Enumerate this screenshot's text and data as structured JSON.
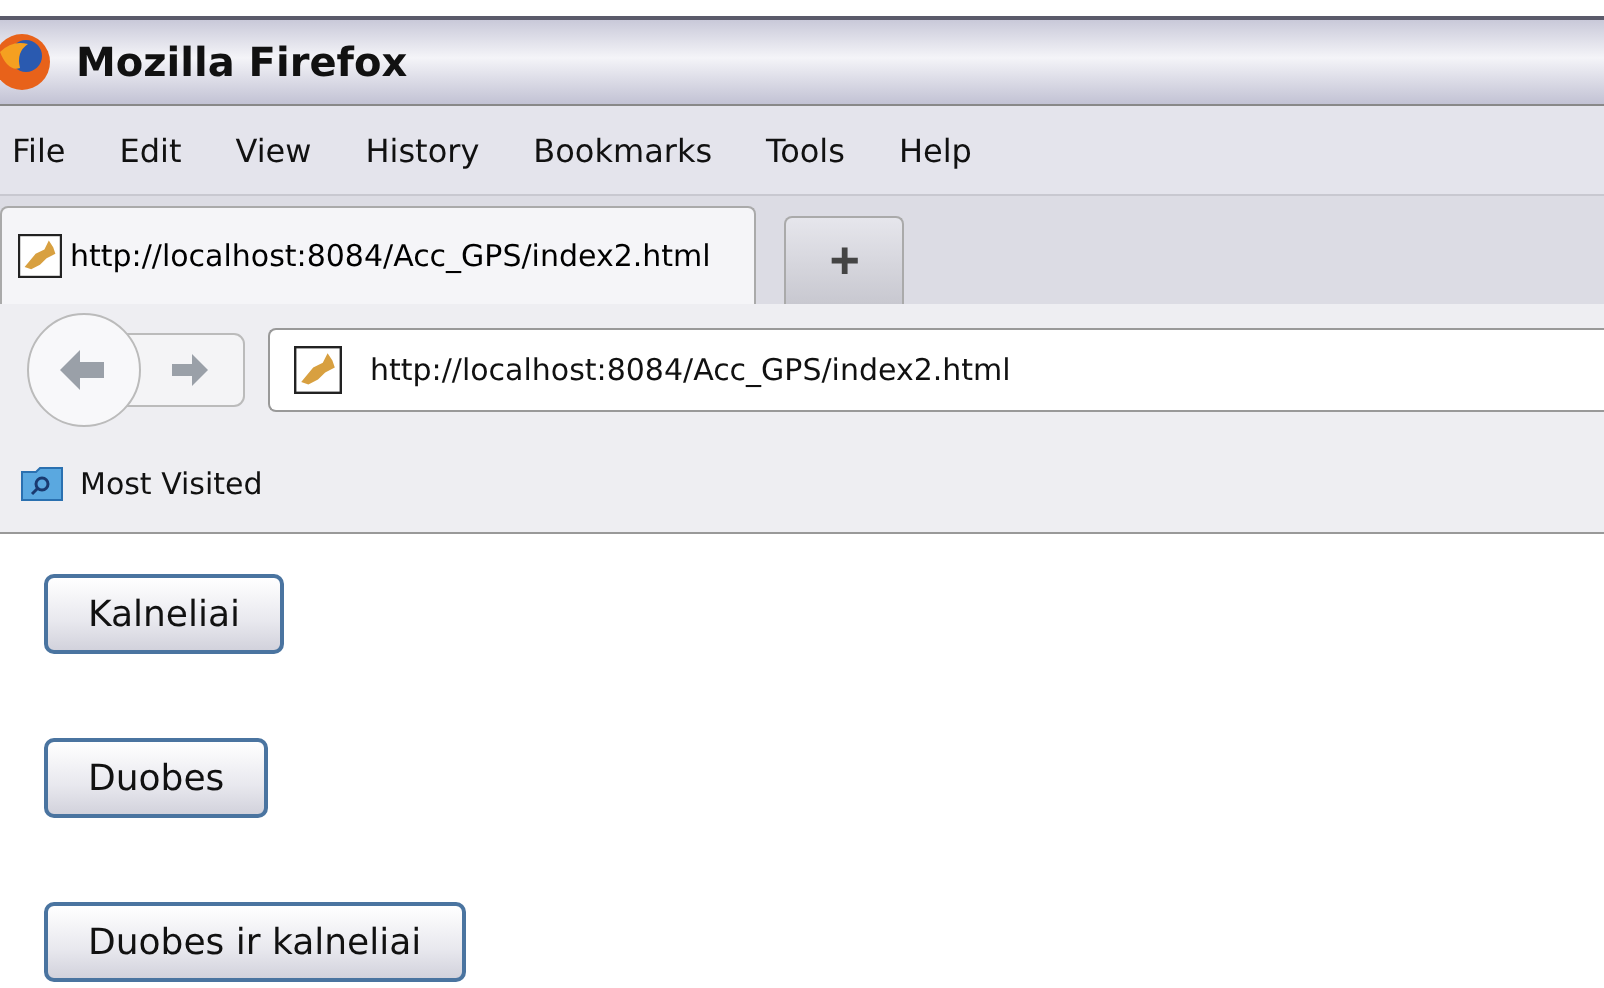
{
  "window": {
    "title": "Mozilla Firefox"
  },
  "menu": [
    "File",
    "Edit",
    "View",
    "History",
    "Bookmarks",
    "Tools",
    "Help"
  ],
  "tabs": [
    {
      "label": "http://localhost:8084/Acc_GPS/index2.html",
      "selected": true
    }
  ],
  "new_tab": "+",
  "address": {
    "value": "http://localhost:8084/Acc_GPS/index2.html"
  },
  "bookmarks": [
    {
      "label": "Most Visited"
    }
  ],
  "buttons": [
    "Kalneliai",
    "Duobes",
    "Duobes ir kalneliai"
  ]
}
